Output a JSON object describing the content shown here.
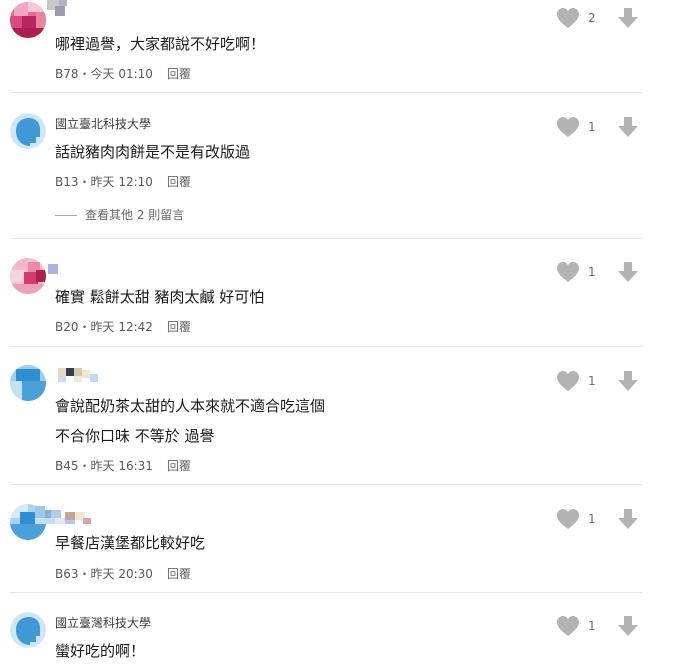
{
  "comments": [
    {
      "name": "",
      "text": "哪裡過譽，大家都說不好吃啊！",
      "floor": "B78",
      "time": "今天 01:10",
      "reply": "回覆",
      "likes": "2"
    },
    {
      "name": "國立臺北科技大學",
      "text": "話說豬肉肉餅是不是有改版過",
      "floor": "B13",
      "time": "昨天 12:10",
      "reply": "回覆",
      "likes": "1",
      "more_replies": "查看其他 2 則留言"
    },
    {
      "name": "",
      "text": "確實  鬆餅太甜  豬肉太鹹  好可怕",
      "floor": "B20",
      "time": "昨天 12:42",
      "reply": "回覆",
      "likes": "1"
    },
    {
      "name": "",
      "text": "會說配奶茶太甜的人本來就不適合吃這個",
      "text2": "不合你口味 不等於 過譽",
      "floor": "B45",
      "time": "昨天 16:31",
      "reply": "回覆",
      "likes": "1"
    },
    {
      "name": "",
      "text": "早餐店漢堡都比較好吃",
      "floor": "B63",
      "time": "昨天 20:30",
      "reply": "回覆",
      "likes": "1"
    },
    {
      "name": "國立臺灣科技大學",
      "text": "蠻好吃的啊！",
      "likes": "1"
    }
  ],
  "separator": "・",
  "icons": {
    "like": "heart-icon",
    "dislike": "down-arrow-icon",
    "default_avatar": "user-avatar-icon"
  },
  "colors": {
    "icon_gray": "#b3b3b3",
    "avatar_blue": "#4a9fd8",
    "avatar_light": "#cfe6f6"
  }
}
